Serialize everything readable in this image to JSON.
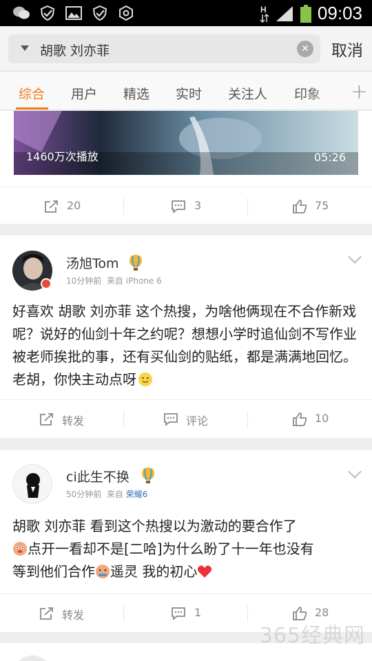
{
  "status_bar": {
    "time": "09:03",
    "left_icons": [
      "wechat-icon",
      "shield-check-icon",
      "image-icon",
      "shield-check-icon",
      "settings-icon"
    ],
    "network_label": "H"
  },
  "search": {
    "query": "胡歌 刘亦菲",
    "cancel_label": "取消"
  },
  "tabs": [
    {
      "label": "综合",
      "active": true
    },
    {
      "label": "用户"
    },
    {
      "label": "精选"
    },
    {
      "label": "实时"
    },
    {
      "label": "关注人"
    },
    {
      "label": "印象"
    }
  ],
  "video_card": {
    "play_count": "1460万次播放",
    "duration": "05:26",
    "actions": {
      "repost": "20",
      "comment": "3",
      "like": "75"
    }
  },
  "posts": [
    {
      "username": "汤旭Tom",
      "time": "10分钟前",
      "source_prefix": "来自",
      "source": "iPhone 6",
      "text": "好喜欢 胡歌 刘亦菲 这个热搜，为啥他俩现在不合作新戏呢？说好的仙剑十年之约呢？想想小学时追仙剑不写作业被老师挨批的事，还有买仙剑的贴纸，都是满满地回忆。老胡，你快主动点呀",
      "actions": {
        "repost": "转发",
        "comment": "评论",
        "like": "10"
      }
    },
    {
      "username": "ci此生不换",
      "time": "50分钟前",
      "source_prefix": "来自",
      "source": "荣耀6",
      "text_line1": "胡歌 刘亦菲 看到这个热搜以为激动的要合作了",
      "text_line2": "点开一看却不是[二哈]为什么盼了十一年也没有",
      "text_line3a": "等到他们合作",
      "text_line3b": "遥灵 我的初心",
      "actions": {
        "repost": "转发",
        "comment": "1",
        "like": "28"
      }
    }
  ],
  "watermark": "365经典网"
}
